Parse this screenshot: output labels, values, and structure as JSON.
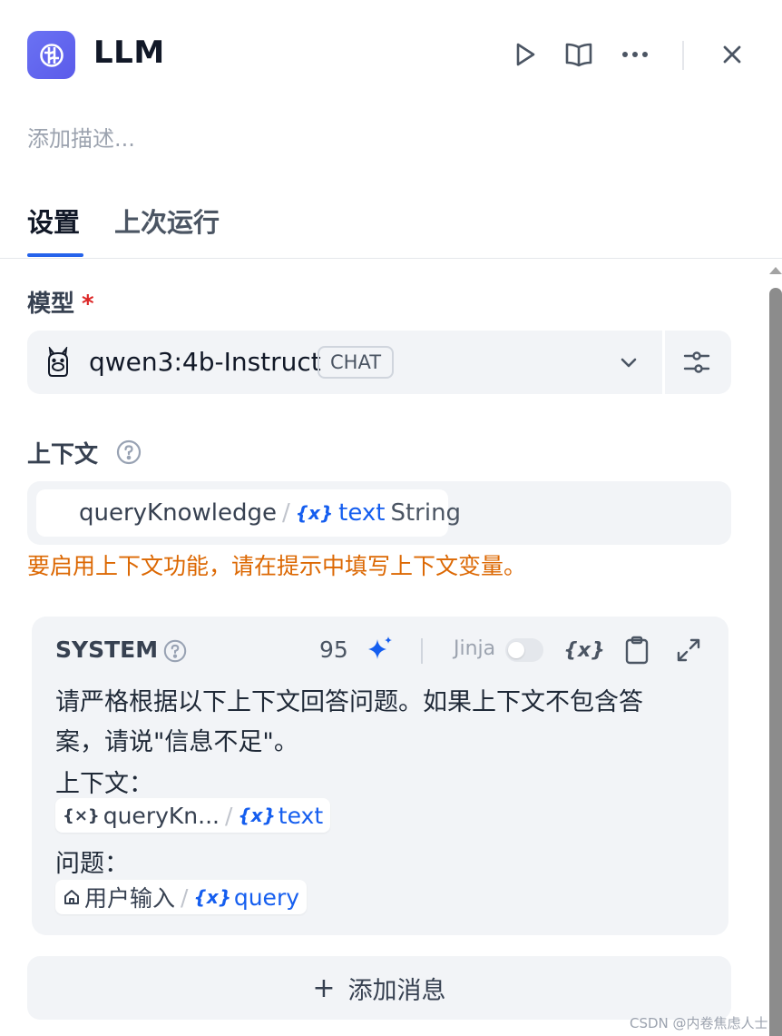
{
  "header": {
    "title": "LLM",
    "description_placeholder": "添加描述..."
  },
  "tabs": [
    {
      "label": "设置",
      "active": true
    },
    {
      "label": "上次运行",
      "active": false
    }
  ],
  "model": {
    "label": "模型",
    "required_mark": "*",
    "name": "qwen3:4b-Instruct",
    "badge": "CHAT"
  },
  "context": {
    "label": "上下文",
    "node": "queryKnowledge",
    "separator": "/",
    "variable": "text",
    "type": "String",
    "warning": "要启用上下文功能，请在提示中填写上下文变量。"
  },
  "system": {
    "role": "SYSTEM",
    "token_count": "95",
    "jinja_label": "Jinja",
    "jinja_enabled": false,
    "prompt_line1": "请严格根据以下上下文回答问题。如果上下文不包含答",
    "prompt_line2": "案，请说\"信息不足\"。",
    "prompt_line3": "上下文：",
    "context_chip": {
      "node": "queryKn...",
      "separator": "/",
      "variable": "text"
    },
    "prompt_line4": "问题：",
    "query_chip": {
      "node": "用户输入",
      "separator": "/",
      "variable": "query"
    }
  },
  "add_message": {
    "plus": "+",
    "label": "添加消息"
  },
  "watermark": "CSDN @内卷焦虑人士",
  "colors": {
    "accent": "#155eef",
    "warning": "#dc6803",
    "required": "#dc2626",
    "app_icon": "#6366f1"
  }
}
